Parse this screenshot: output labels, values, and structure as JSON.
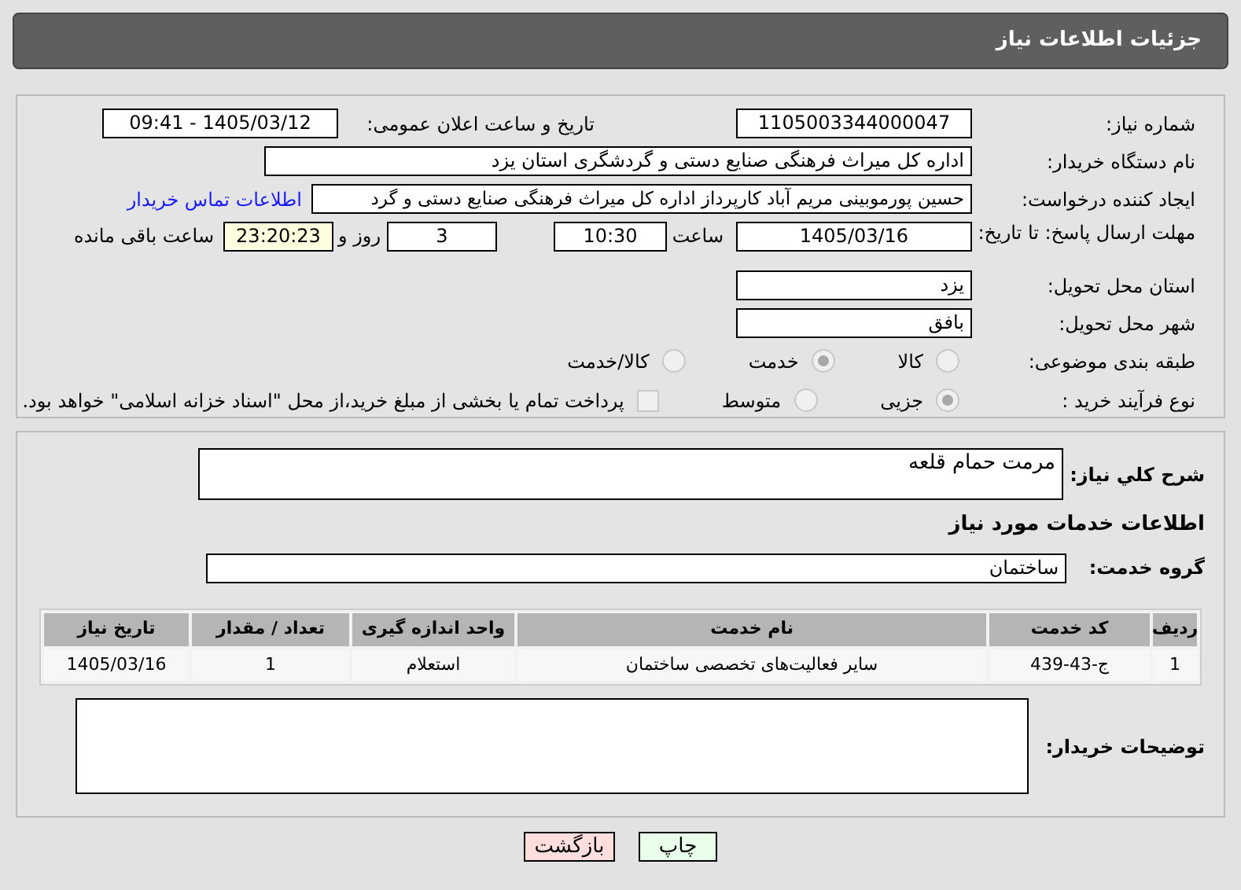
{
  "header": {
    "title": "جزئیات اطلاعات نیاز"
  },
  "need_number": {
    "label": "شماره نیاز:",
    "value": "1105003344000047"
  },
  "announce_date": {
    "label": "تاریخ و ساعت اعلان عمومی:",
    "value": "1405/03/12 - 09:41"
  },
  "buyer_org": {
    "label": "نام دستگاه خریدار:",
    "value": "اداره کل میراث فرهنگی  صنایع دستی و گردشگری استان یزد"
  },
  "requester": {
    "label": "ایجاد کننده درخواست:",
    "value": "حسین پورموبینی مریم آباد کارپرداز اداره کل میراث فرهنگی  صنایع دستی و گرد",
    "link": "اطلاعات تماس خریدار"
  },
  "deadline": {
    "label": "مهلت ارسال پاسخ: تا تاریخ:",
    "date": "1405/03/16",
    "time_label": "ساعت",
    "time": "10:30",
    "days": "3",
    "days_label": "روز و",
    "remaining": "23:20:23",
    "remaining_label": "ساعت باقی مانده"
  },
  "province": {
    "label": "استان محل تحویل:",
    "value": "یزد"
  },
  "city": {
    "label": "شهر محل تحویل:",
    "value": "بافق"
  },
  "category": {
    "label": "طبقه بندی موضوعی:",
    "options": [
      {
        "label": "کالا",
        "selected": false
      },
      {
        "label": "خدمت",
        "selected": true
      },
      {
        "label": "کالا/خدمت",
        "selected": false
      }
    ]
  },
  "purchase_type": {
    "label": "نوع فرآیند خرید :",
    "options": [
      {
        "label": "جزیی",
        "selected": true
      },
      {
        "label": "متوسط",
        "selected": false
      }
    ],
    "payment_note": {
      "label": "پرداخت تمام یا بخشی از مبلغ خرید،از محل \"اسناد خزانه اسلامی\" خواهد بود.",
      "checked": false
    }
  },
  "description": {
    "label": "شرح کلي نياز:",
    "value": "مرمت  حمام قلعه"
  },
  "services_heading": "اطلاعات خدمات مورد نياز",
  "service_group": {
    "label": "گروه خدمت:",
    "value": "ساختمان"
  },
  "table": {
    "columns": [
      "ردیف",
      "کد خدمت",
      "نام خدمت",
      "واحد اندازه گیری",
      "تعداد / مقدار",
      "تاریخ نیاز"
    ],
    "rows": [
      [
        "1",
        "ج-43-439",
        "سایر فعالیت‌های تخصصی ساختمان",
        "استعلام",
        "1",
        "1405/03/16"
      ]
    ]
  },
  "buyer_notes": {
    "label": "توضیحات خریدار:"
  },
  "buttons": [
    {
      "label": "چاپ",
      "kind": "print"
    },
    {
      "label": "بازگشت",
      "kind": "back"
    }
  ]
}
